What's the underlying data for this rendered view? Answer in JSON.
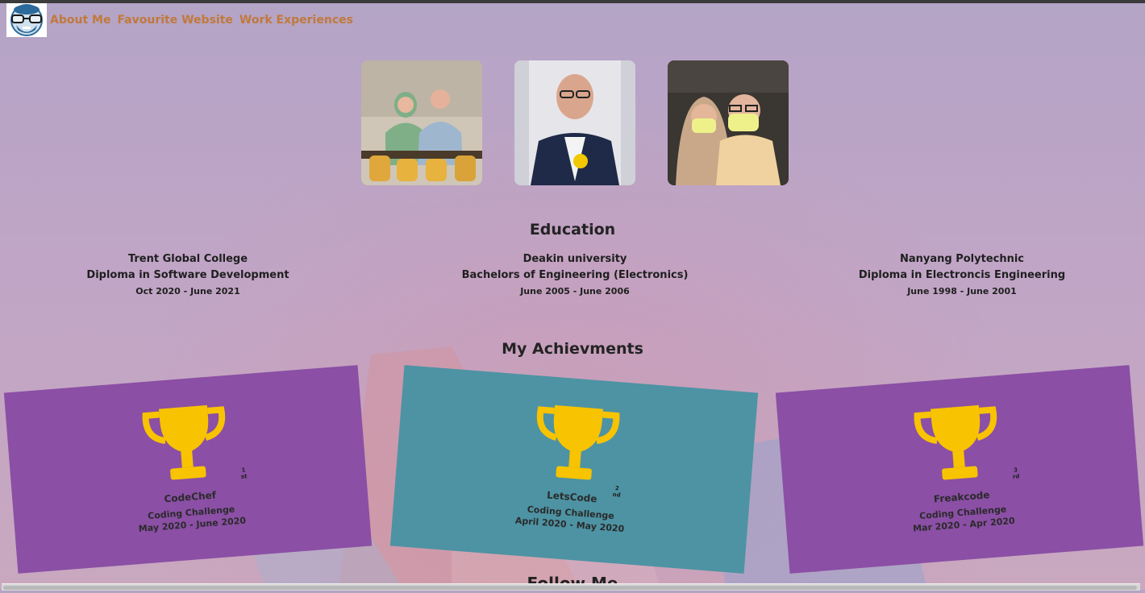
{
  "nav": {
    "links": [
      "About Me",
      "Favourite Website",
      "Work Experiences"
    ]
  },
  "education": {
    "title": "Education",
    "items": [
      {
        "school": "Trent Global College",
        "degree": "Diploma in Software Development",
        "dates": "Oct 2020 - June 2021"
      },
      {
        "school": "Deakin university",
        "degree": "Bachelors of Engineering (Electronics)",
        "dates": "June 2005 - June 2006"
      },
      {
        "school": "Nanyang Polytechnic",
        "degree": "Diploma in Electroncis Engineering",
        "dates": "June 1998 - June 2001"
      }
    ]
  },
  "achievements": {
    "title": "My Achievments",
    "items": [
      {
        "rank": "1 st",
        "name": "CodeChef",
        "challenge": "Coding Challenge",
        "dates": "May 2020 - June 2020",
        "color": "#8b4fa5"
      },
      {
        "rank": "2 nd",
        "name": "LetsCode",
        "challenge": "Coding Challenge",
        "dates": "April 2020 - May 2020",
        "color": "#4d93a3"
      },
      {
        "rank": "3 rd",
        "name": "Freakcode",
        "challenge": "Coding Challenge",
        "dates": "Mar 2020 - Apr 2020",
        "color": "#8b4fa5"
      }
    ]
  },
  "follow": {
    "title": "Follow Me"
  },
  "colors": {
    "nav_link": "#c0793b",
    "trophy": "#f8c300",
    "purple_card": "#8b4fa5",
    "teal_card": "#4d93a3"
  },
  "icons": [
    "logo-avatar-icon",
    "trophy-icon"
  ]
}
